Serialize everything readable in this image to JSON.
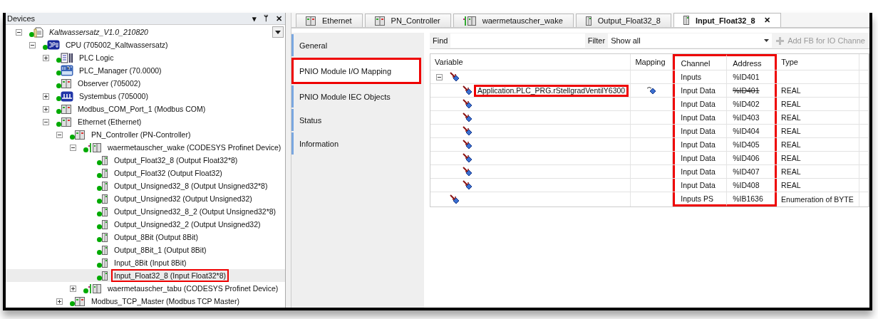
{
  "devices_panel": {
    "title": "Devices",
    "header_icons": [
      "▾",
      "ᛘ",
      "✕"
    ],
    "tree": [
      {
        "label": "Kaltwassersatz_V1.0_210820",
        "kind": "project",
        "expanded": true,
        "selected": false,
        "highlighted": false,
        "children": [
          {
            "label": "CPU (705002_Kaltwassersatz)",
            "kind": "cpu",
            "expanded": true,
            "selected": false,
            "highlighted": false,
            "children": [
              {
                "label": "PLC Logic",
                "kind": "logic",
                "expanded": false,
                "selected": false,
                "highlighted": false
              },
              {
                "label": "PLC_Manager (70.0000)",
                "kind": "plc",
                "selected": false,
                "highlighted": false
              },
              {
                "label": "Observer (705002)",
                "kind": "device",
                "selected": false,
                "highlighted": false
              },
              {
                "label": "Systembus (705000)",
                "kind": "bus",
                "expanded": false,
                "selected": false,
                "highlighted": false
              },
              {
                "label": "Modbus_COM_Port_1 (Modbus COM)",
                "kind": "device",
                "expanded": false,
                "selected": false,
                "highlighted": false
              },
              {
                "label": "Ethernet (Ethernet)",
                "kind": "device",
                "expanded": true,
                "selected": false,
                "highlighted": false,
                "children": [
                  {
                    "label": "PN_Controller (PN-Controller)",
                    "kind": "device",
                    "expanded": true,
                    "selected": false,
                    "highlighted": false,
                    "children": [
                      {
                        "label": "waermetauscher_wake (CODESYS Profinet Device)",
                        "kind": "profinet",
                        "expanded": true,
                        "selected": false,
                        "highlighted": false,
                        "children": [
                          {
                            "label": "Output_Float32_8 (Output Float32*8)",
                            "kind": "module",
                            "selected": false,
                            "highlighted": false
                          },
                          {
                            "label": "Output_Float32 (Output Float32)",
                            "kind": "module",
                            "selected": false,
                            "highlighted": false
                          },
                          {
                            "label": "Output_Unsigned32_8 (Output Unsigned32*8)",
                            "kind": "module",
                            "selected": false,
                            "highlighted": false
                          },
                          {
                            "label": "Output_Unsigned32 (Output Unsigned32)",
                            "kind": "module",
                            "selected": false,
                            "highlighted": false
                          },
                          {
                            "label": "Output_Unsigned32_8_2 (Output Unsigned32*8)",
                            "kind": "module",
                            "selected": false,
                            "highlighted": false
                          },
                          {
                            "label": "Output_Unsigned32_2 (Output Unsigned32)",
                            "kind": "module",
                            "selected": false,
                            "highlighted": false
                          },
                          {
                            "label": "Output_8Bit (Output 8Bit)",
                            "kind": "module",
                            "selected": false,
                            "highlighted": false
                          },
                          {
                            "label": "Output_8Bit_1 (Output 8Bit)",
                            "kind": "module",
                            "selected": false,
                            "highlighted": false
                          },
                          {
                            "label": "Input_8Bit (Input 8Bit)",
                            "kind": "module",
                            "selected": false,
                            "highlighted": false
                          },
                          {
                            "label": "Input_Float32_8 (Input Float32*8)",
                            "kind": "module",
                            "selected": true,
                            "highlighted": true
                          }
                        ]
                      },
                      {
                        "label": "waermetauscher_tabu (CODESYS Profinet Device)",
                        "kind": "profinet",
                        "expanded": false,
                        "selected": false,
                        "highlighted": false
                      }
                    ]
                  },
                  {
                    "label": "Modbus_TCP_Master (Modbus TCP Master)",
                    "kind": "device",
                    "expanded": false,
                    "selected": false,
                    "highlighted": false
                  }
                ]
              }
            ]
          }
        ]
      }
    ]
  },
  "editor_tabs": [
    {
      "label": "Ethernet",
      "kind": "device",
      "selected": false
    },
    {
      "label": "PN_Controller",
      "kind": "device",
      "selected": false
    },
    {
      "label": "waermetauscher_wake",
      "kind": "profinet",
      "selected": false
    },
    {
      "label": "Output_Float32_8",
      "kind": "module",
      "selected": false
    },
    {
      "label": "Input_Float32_8",
      "kind": "module",
      "selected": true,
      "close": "✕"
    }
  ],
  "pages": [
    {
      "label": "General",
      "selected": false,
      "highlighted": false
    },
    {
      "label": "PNIO Module I/O Mapping",
      "selected": true,
      "highlighted": true
    },
    {
      "label": "PNIO Module IEC Objects",
      "selected": false,
      "highlighted": false
    },
    {
      "label": "Status",
      "selected": false,
      "highlighted": false
    },
    {
      "label": "Information",
      "selected": false,
      "highlighted": false
    }
  ],
  "toolbar": {
    "find_label": "Find",
    "filter_label": "Filter",
    "filter_value": "Show all",
    "add_button": {
      "label": "Add FB for IO Channe",
      "disabled": true
    }
  },
  "table": {
    "columns": [
      {
        "label": "Variable",
        "highlighted": false
      },
      {
        "label": "Mapping",
        "highlighted": false
      },
      {
        "label": "Channel",
        "highlighted": true
      },
      {
        "label": "Address",
        "highlighted": true
      },
      {
        "label": "Type",
        "highlighted": false
      }
    ],
    "rows": [
      {
        "channel": "Inputs",
        "address": "%ID401",
        "struck": false,
        "expanded": true,
        "mapped": false,
        "children": [
          {
            "variable": "Application.PLC_PRG.rStellgradVentilY6300",
            "highlighted": true,
            "mapped": true,
            "channel": "Input Data",
            "address": "%ID401",
            "struck": true,
            "type": "REAL"
          },
          {
            "mapped": false,
            "channel": "Input Data",
            "address": "%ID402",
            "struck": false,
            "type": "REAL"
          },
          {
            "mapped": false,
            "channel": "Input Data",
            "address": "%ID403",
            "struck": false,
            "type": "REAL"
          },
          {
            "mapped": false,
            "channel": "Input Data",
            "address": "%ID404",
            "struck": false,
            "type": "REAL"
          },
          {
            "mapped": false,
            "channel": "Input Data",
            "address": "%ID405",
            "struck": false,
            "type": "REAL"
          },
          {
            "mapped": false,
            "channel": "Input Data",
            "address": "%ID406",
            "struck": false,
            "type": "REAL"
          },
          {
            "mapped": false,
            "channel": "Input Data",
            "address": "%ID407",
            "struck": false,
            "type": "REAL"
          },
          {
            "mapped": false,
            "channel": "Input Data",
            "address": "%ID408",
            "struck": false,
            "type": "REAL"
          }
        ]
      },
      {
        "mapped": false,
        "channel": "Inputs PS",
        "address": "%IB1636",
        "struck": false,
        "type": "Enumeration of BYTE"
      }
    ]
  }
}
